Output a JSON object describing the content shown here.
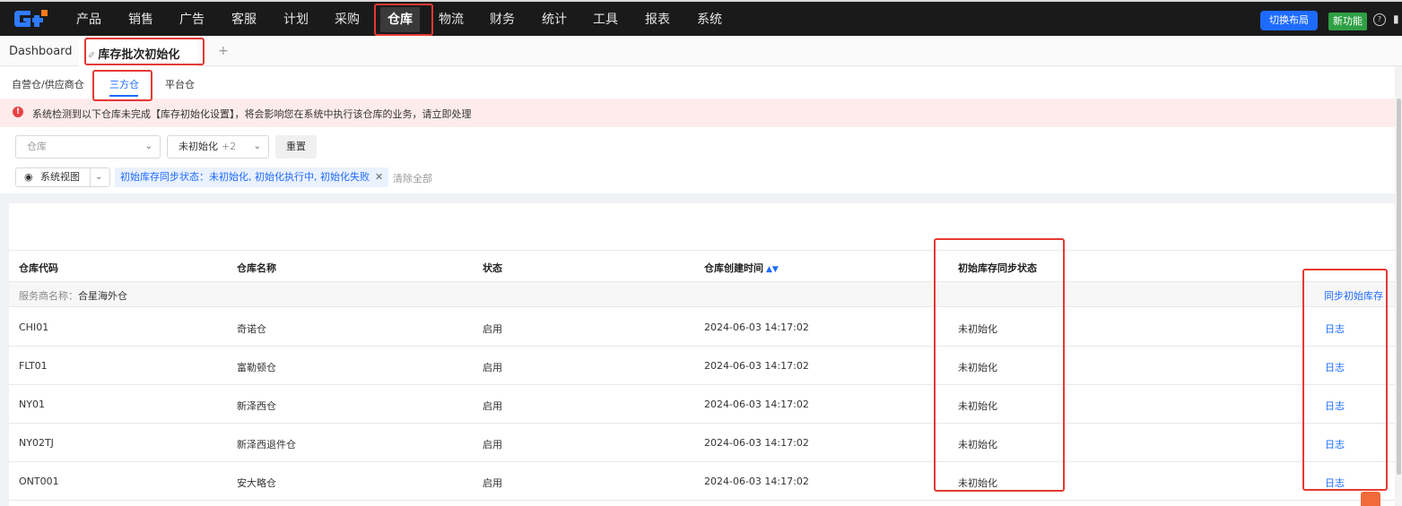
{
  "nav": {
    "logo": "G",
    "items": [
      "产品",
      "销售",
      "广告",
      "客服",
      "计划",
      "采购",
      "仓库",
      "物流",
      "财务",
      "统计",
      "工具",
      "报表",
      "系统"
    ],
    "active_index": 6,
    "layout_btn": "切换布局",
    "new_feature_btn": "新功能",
    "accent": "#1e6bff"
  },
  "tabs": {
    "dashboard": "Dashboard",
    "active": "库存批次初始化",
    "pin_icon": "pin-icon",
    "add": "+"
  },
  "subtabs": [
    "自营仓/供应商仓",
    "三方仓",
    "平台仓"
  ],
  "alert": {
    "icon": "!",
    "text": "系统检测到以下仓库未完成【库存初始化设置】，将会影响您在系统中执行该仓库的业务，请立即处理"
  },
  "filters": {
    "warehouse_placeholder": "仓库",
    "status_value": "未初始化",
    "status_more": "+2",
    "reset": "重置",
    "view_label": "系统视图",
    "tag": "初始库存同步状态：未初始化, 初始化执行中, 初始化失败",
    "clear_all": "清除全部"
  },
  "table": {
    "columns": [
      "仓库代码",
      "仓库名称",
      "状态",
      "仓库创建时间",
      "初始库存同步状态"
    ],
    "group": {
      "label": "服务商名称：",
      "value": "合星海外仓",
      "action": "同步初始库存"
    },
    "rows": [
      {
        "code": "CHI01",
        "name": "奇诺仓",
        "status": "启用",
        "created": "2024-06-03 14:17:02",
        "sync": "未初始化",
        "action": "日志"
      },
      {
        "code": "FLT01",
        "name": "富勒顿仓",
        "status": "启用",
        "created": "2024-06-03 14:17:02",
        "sync": "未初始化",
        "action": "日志"
      },
      {
        "code": "NY01",
        "name": "新泽西仓",
        "status": "启用",
        "created": "2024-06-03 14:17:02",
        "sync": "未初始化",
        "action": "日志"
      },
      {
        "code": "NY02TJ",
        "name": "新泽西退件仓",
        "status": "启用",
        "created": "2024-06-03 14:17:02",
        "sync": "未初始化",
        "action": "日志"
      },
      {
        "code": "ONT001",
        "name": "安大略仓",
        "status": "启用",
        "created": "2024-06-03 14:17:02",
        "sync": "未初始化",
        "action": "日志"
      }
    ]
  }
}
